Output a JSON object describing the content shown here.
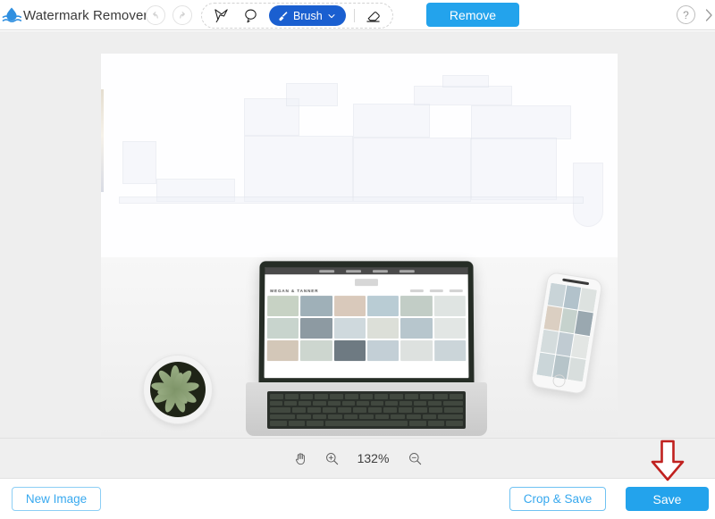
{
  "app": {
    "title": "Watermark Remover",
    "logo_icon": "water-drop-wave-logo",
    "accent_blue": "#23a3ec",
    "brush_blue": "#1a5fd0",
    "annotation_red": "#c0211f"
  },
  "toolbar": {
    "undo_icon": "undo-arrow-icon",
    "redo_icon": "redo-arrow-icon",
    "polygon_tool_icon": "polygon-lasso-icon",
    "free_select_tool_icon": "free-select-lasso-icon",
    "brush_label": "Brush",
    "brush_icon": "paintbrush-icon",
    "brush_dropdown_icon": "chevron-down-icon",
    "eraser_icon": "eraser-icon",
    "remove_label": "Remove",
    "help_label": "?",
    "help_icon": "question-mark-icon",
    "collapse_icon": "chevron-right-icon"
  },
  "canvas": {
    "image_alt": "Laptop, succulent plant and smartphone on white desk with watermark removed from upper area",
    "laptop": {
      "site_title": "MEGAN & TANNER"
    }
  },
  "zoombar": {
    "hand_tool_icon": "hand-pan-icon",
    "zoom_in_icon": "magnifier-plus-icon",
    "zoom_level": "132%",
    "zoom_out_icon": "magnifier-minus-icon"
  },
  "bottombar": {
    "new_image_label": "New Image",
    "crop_save_label": "Crop & Save",
    "save_label": "Save"
  },
  "annotation": {
    "arrow_icon": "red-down-arrow-icon",
    "points_at": "Save"
  }
}
